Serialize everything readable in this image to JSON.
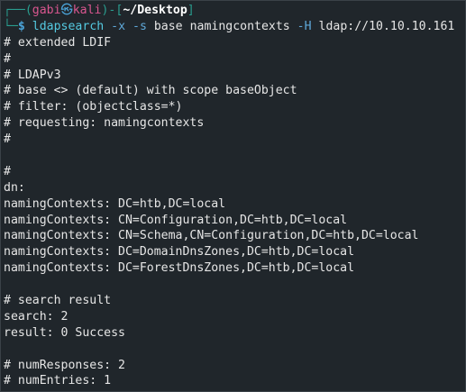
{
  "terminal": {
    "prompt": {
      "open_corner": "┌──(",
      "user": "gabi",
      "at": "㉿",
      "host": "kali",
      "close_open": ")-[",
      "cwd": "~/Desktop",
      "close": "]",
      "bottom_corner": "└─",
      "dollar": "$"
    },
    "command": {
      "name": "ldapsearch",
      "flag1": "-x",
      "flag2": "-s",
      "arg1": "base",
      "arg2": "namingcontexts",
      "flag3": "-H",
      "arg3": "ldap://10.10.10.161"
    },
    "output": [
      "# extended LDIF",
      "#",
      "# LDAPv3",
      "# base <> (default) with scope baseObject",
      "# filter: (objectclass=*)",
      "# requesting: namingcontexts",
      "#",
      "",
      "#",
      "dn:",
      "namingContexts: DC=htb,DC=local",
      "namingContexts: CN=Configuration,DC=htb,DC=local",
      "namingContexts: CN=Schema,CN=Configuration,DC=htb,DC=local",
      "namingContexts: DC=DomainDnsZones,DC=htb,DC=local",
      "namingContexts: DC=ForestDnsZones,DC=htb,DC=local",
      "",
      "# search result",
      "search: 2",
      "result: 0 Success",
      "",
      "# numResponses: 2",
      "# numEntries: 1"
    ]
  }
}
